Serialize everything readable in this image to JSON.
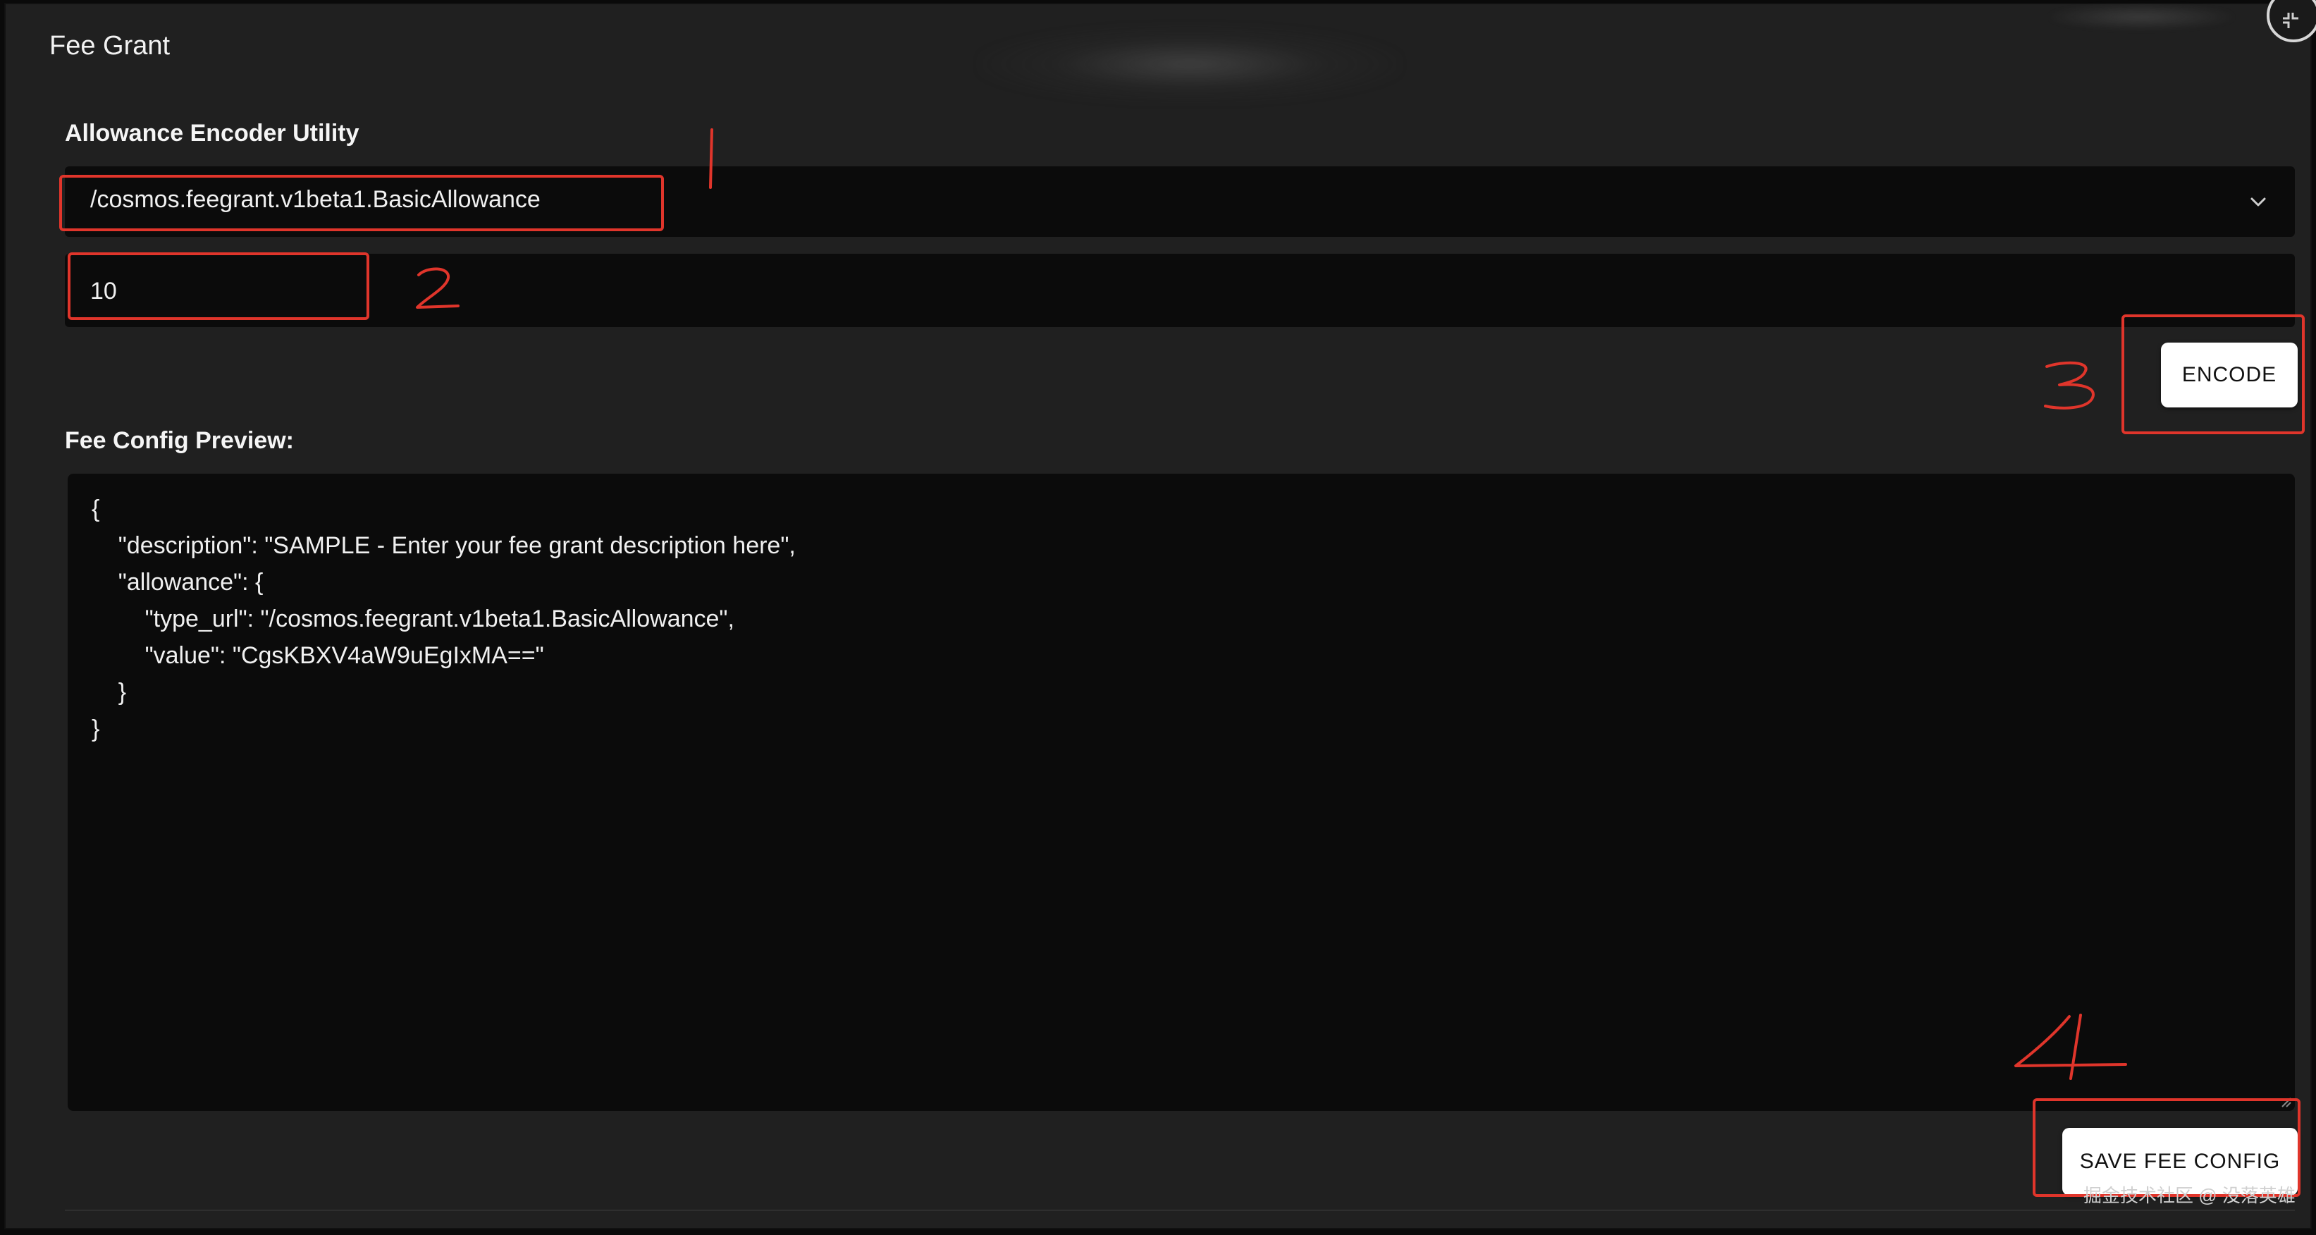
{
  "app": {
    "title": "Fee Grant"
  },
  "encoder": {
    "section_label": "Allowance Encoder Utility",
    "allowance_type_selected": "/cosmos.feegrant.v1beta1.BasicAllowance",
    "amount_value": "10",
    "encode_label": "ENCODE"
  },
  "preview": {
    "section_label": "Fee Config Preview:",
    "content": "{\n    \"description\": \"SAMPLE - Enter your fee grant description here\",\n    \"allowance\": {\n        \"type_url\": \"/cosmos.feegrant.v1beta1.BasicAllowance\",\n        \"value\": \"CgsKBXV4aW9uEgIxMA==\"\n    }\n}"
  },
  "actions": {
    "save_label": "SAVE FEE CONFIG"
  },
  "annotations": {
    "color": "#e0352b",
    "numbers": [
      "1",
      "2",
      "3",
      "4"
    ]
  },
  "watermark": {
    "text": "掘金技术社区 @ 没落英雄"
  },
  "icons": {
    "dropdown": "chevron-down-icon",
    "corner": "collapse-icon",
    "resize": "resize-grip-icon"
  }
}
